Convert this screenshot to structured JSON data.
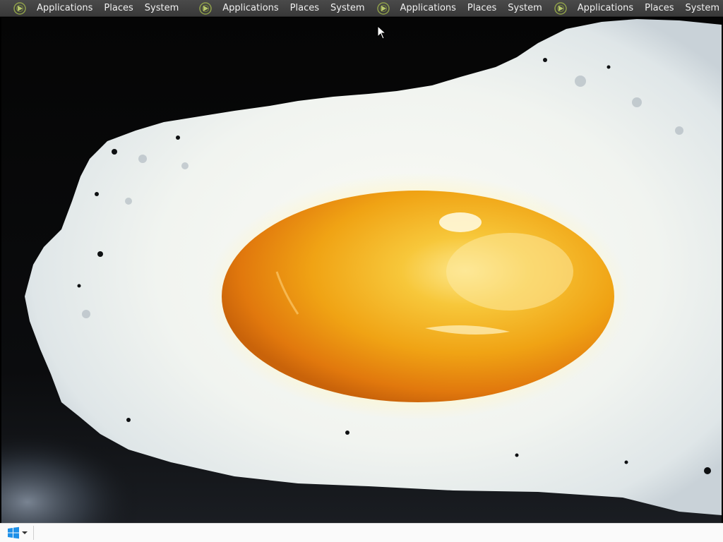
{
  "top_panel": {
    "menus": [
      {
        "icon": "apps-icon",
        "applications": "Applications",
        "places": "Places",
        "system": "System"
      },
      {
        "icon": "apps-icon",
        "applications": "Applications",
        "places": "Places",
        "system": "System"
      },
      {
        "icon": "apps-icon",
        "applications": "Applications",
        "places": "Places",
        "system": "System"
      },
      {
        "icon": "apps-icon",
        "applications": "Applications",
        "places": "Places",
        "system": "System"
      }
    ]
  },
  "desktop": {
    "wallpaper": "fried-egg-wallpaper"
  },
  "bottom_panel": {
    "start_icon": "windows-logo-icon",
    "start_dropdown_icon": "dropdown-arrow-icon"
  },
  "colors": {
    "panel_bg": "#3f3f3f",
    "panel_text": "#f0f0f0",
    "taskbar_bg": "#fafafa",
    "yolk": "#f2a20f",
    "egg_white": "#f4f6f2"
  }
}
